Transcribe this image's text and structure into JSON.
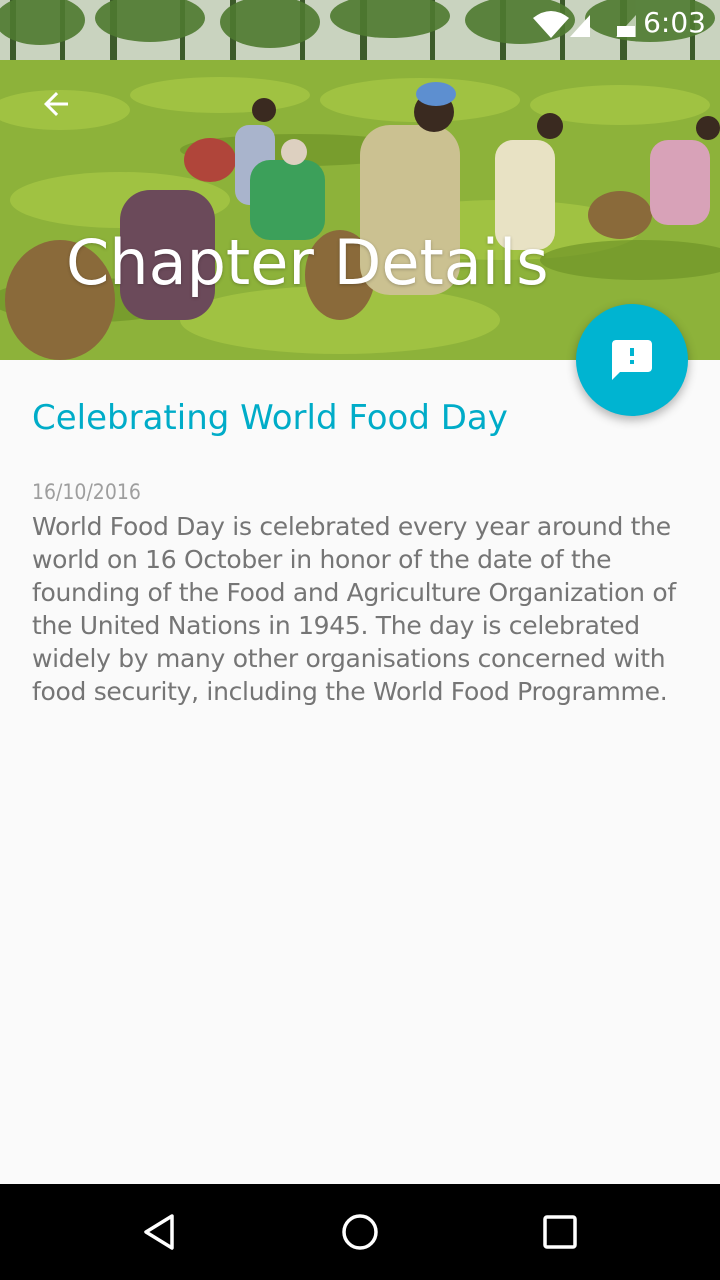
{
  "status_bar": {
    "time": "6:03",
    "icons": [
      "wifi-icon",
      "cellular-signal-icon",
      "battery-icon"
    ]
  },
  "toolbar": {
    "title": "Chapter Details",
    "back_icon": "arrow-back-icon"
  },
  "fab": {
    "icon": "feedback-icon",
    "color": "#00b4d1"
  },
  "article": {
    "title": "Celebrating World Food Day",
    "date": "16/10/2016",
    "body": "World Food Day is celebrated every year around the world on 16 October in honor of the date of the founding of the Food and Agriculture Organization of the United Nations in 1945. The day is celebrated widely by many other organisations concerned with food security, including the World Food Programme."
  },
  "navigation_bar": {
    "icons": [
      "back-triangle-icon",
      "home-circle-icon",
      "recents-square-icon"
    ]
  },
  "colors": {
    "accent": "#00acc8",
    "background": "#fafafa",
    "body_text": "#757575",
    "date_text": "#9e9e9e"
  }
}
